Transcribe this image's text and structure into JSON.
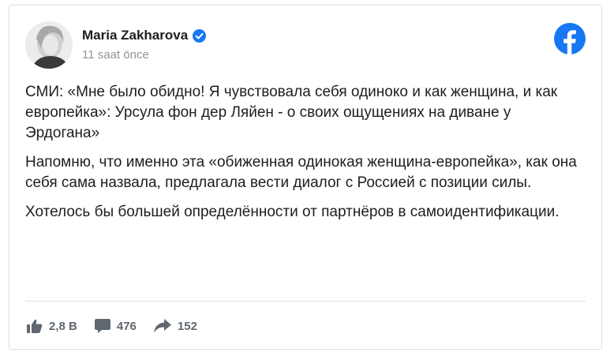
{
  "post": {
    "author": "Maria Zakharova",
    "timestamp": "11 saat önce",
    "verified": true,
    "paragraphs": [
      "СМИ: «Мне было обидно! Я чувствовала себя одиноко и как женщина, и как европейка»: Урсула фон дер Ляйен - о своих ощущениях на диване у Эрдогана»",
      "Напомню, что именно эта «обиженная одинокая женщина-европейка», как она себя сама назвала, предлагала вести диалог с Россией с позиции силы.",
      "Хотелось бы большей определённости от партнёров в самоидентификации."
    ]
  },
  "stats": {
    "likes": "2,8 B",
    "comments": "476",
    "shares": "152"
  },
  "icons": {
    "platform": "facebook-icon",
    "verified": "verified-badge-icon",
    "like": "thumbs-up-icon",
    "comment": "comment-icon",
    "share": "share-arrow-icon"
  },
  "colors": {
    "facebook_blue": "#1877f2",
    "text": "#1c1e21",
    "muted": "#90949c",
    "footer": "#606770"
  }
}
